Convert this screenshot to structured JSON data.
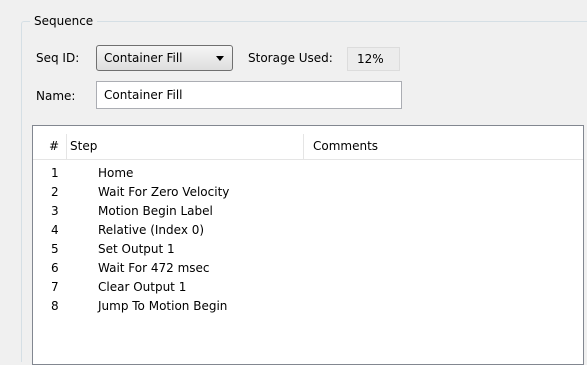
{
  "sequence": {
    "group_label": "Sequence",
    "seq_id_label": "Seq ID:",
    "seq_id_value": "Container Fill",
    "storage_used_label": "Storage Used:",
    "storage_used_value": "12%",
    "name_label": "Name:",
    "name_value": "Container Fill"
  },
  "steps_table": {
    "columns": [
      "#",
      "Step",
      "Comments"
    ],
    "rows": [
      {
        "num": "1",
        "step": "Home",
        "comment": ""
      },
      {
        "num": "2",
        "step": "Wait For Zero Velocity",
        "comment": ""
      },
      {
        "num": "3",
        "step": "Motion Begin Label",
        "comment": ""
      },
      {
        "num": "4",
        "step": "Relative (Index 0)",
        "comment": ""
      },
      {
        "num": "5",
        "step": "Set Output 1",
        "comment": ""
      },
      {
        "num": "6",
        "step": "Wait For 472 msec",
        "comment": ""
      },
      {
        "num": "7",
        "step": "Clear Output 1",
        "comment": ""
      },
      {
        "num": "8",
        "step": "Jump To Motion Begin",
        "comment": ""
      }
    ]
  },
  "icons": {
    "combo_arrow": "chevron-down-icon"
  }
}
